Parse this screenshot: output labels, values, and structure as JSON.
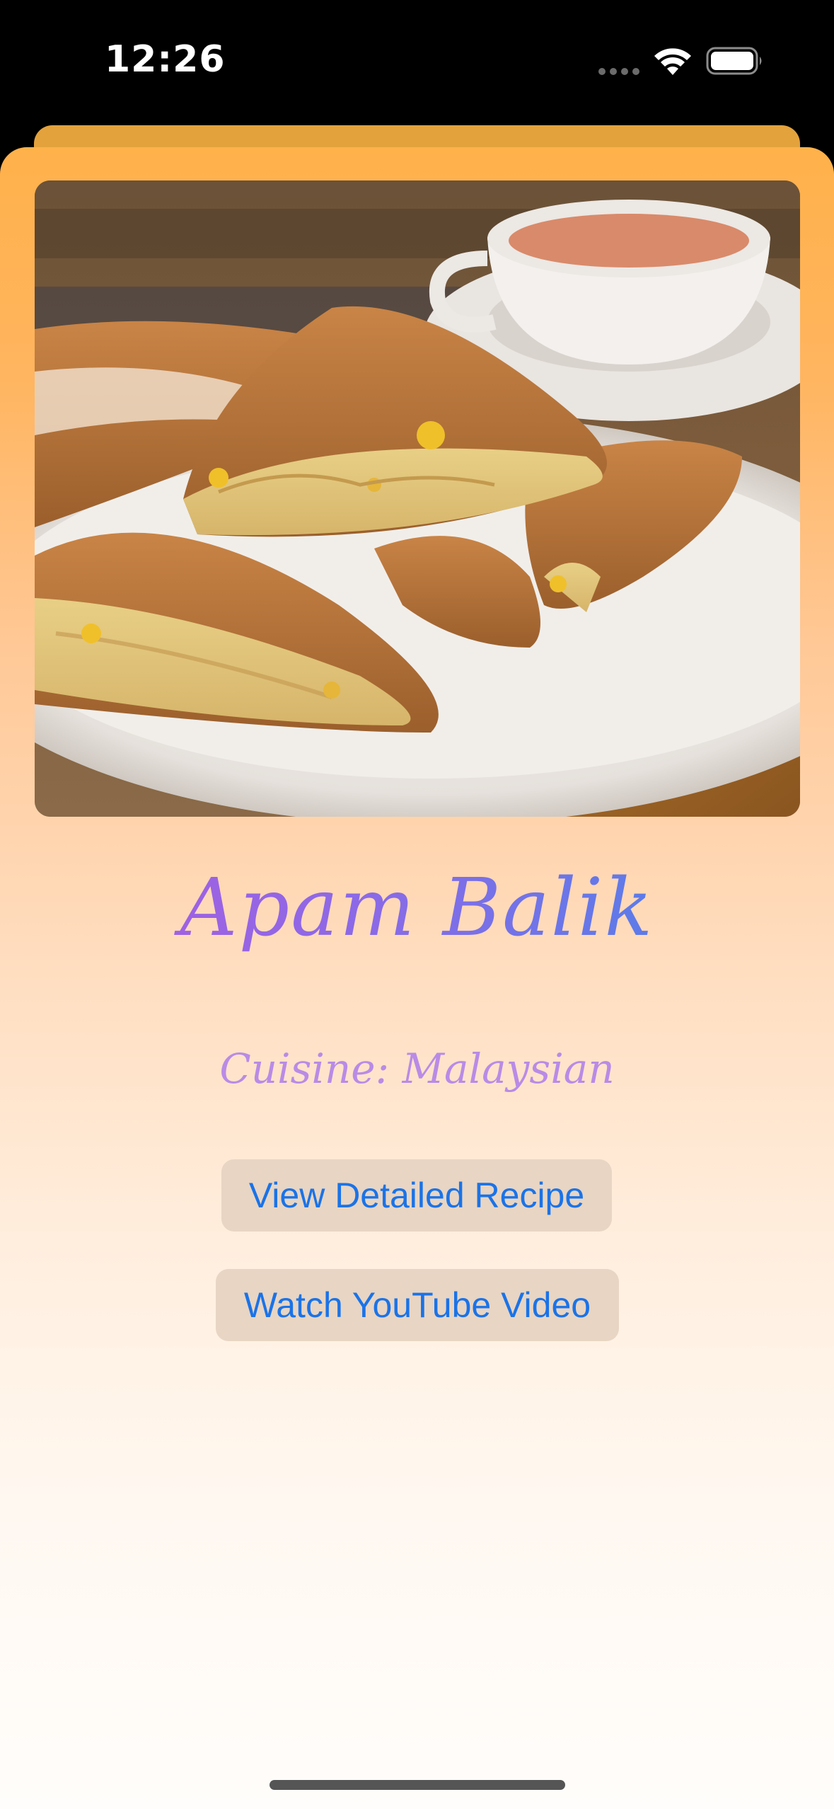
{
  "status_bar": {
    "time": "12:26",
    "icons": [
      "cellular-signal-icon",
      "wifi-icon",
      "battery-icon"
    ]
  },
  "meal": {
    "image_alt": "Apam Balik",
    "title": "Apam Balik",
    "cuisine": "Cuisine: Malaysian"
  },
  "actions": {
    "recipe_label": "View Detailed Recipe",
    "youtube_label": "Watch YouTube Video"
  },
  "colors": {
    "sheet_top": "#ffb14a",
    "sheet_bottom": "#fffdfb",
    "back_card": "#e3a23c",
    "button_bg": "#e8d5c3",
    "button_text": "#1a73e8",
    "title_gradient_start": "#b05ae0",
    "title_gradient_end": "#3f86ea",
    "cuisine_text": "#b98be6"
  }
}
